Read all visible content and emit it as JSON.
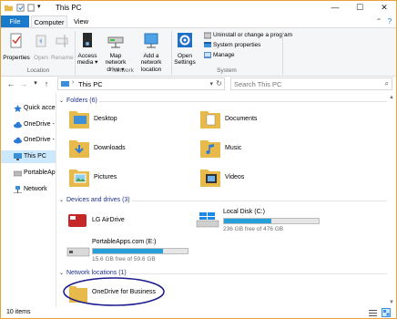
{
  "window": {
    "title": "This PC",
    "controls": {
      "minimize": "—",
      "maximize": "☐",
      "close": "✕"
    }
  },
  "ribbon": {
    "tabs": {
      "file": "File",
      "computer": "Computer",
      "view": "View"
    },
    "location": {
      "label": "Location",
      "properties": "Properties",
      "open": "Open",
      "rename": "Rename"
    },
    "network": {
      "label": "Network",
      "access_media": [
        "Access",
        "media ▾"
      ],
      "map_drive": [
        "Map network",
        "drive ▾"
      ],
      "add_location": [
        "Add a network",
        "location"
      ]
    },
    "system": {
      "label": "System",
      "open_settings": [
        "Open",
        "Settings"
      ],
      "uninstall": "Uninstall or change a program",
      "system_properties": "System properties",
      "manage": "Manage"
    }
  },
  "address_bar": {
    "path": "This PC",
    "search_placeholder": "Search This PC"
  },
  "nav_pane": {
    "items": [
      "Quick access",
      "OneDrive - ",
      "OneDrive - ",
      "This PC",
      "PortableApps",
      "Network"
    ],
    "selected": "This PC"
  },
  "groups": {
    "folders": "Folders (6)",
    "devices": "Devices and drives (3)",
    "network": "Network locations (1)"
  },
  "folders": [
    "Desktop",
    "Documents",
    "Downloads",
    "Music",
    "Pictures",
    "Videos"
  ],
  "drives": [
    {
      "name": "LG AirDrive",
      "free": "",
      "used_fraction": null
    },
    {
      "name": "Local Disk (C:)",
      "free": "236 GB free of 476 GB",
      "used_fraction": 0.5
    },
    {
      "name": "PortableApps.com (E:)",
      "free": "15.6 GB free of 59.6 GB",
      "used_fraction": 0.74
    }
  ],
  "network_locations": [
    "OneDrive for Business"
  ],
  "status": {
    "items": "10 items"
  },
  "colors": {
    "accent": "#1979ca",
    "drive_fill": "#26a0da",
    "selection": "#cce8ff",
    "highlight_ellipse": "#1a1a8c",
    "group_header": "#1e3287"
  }
}
